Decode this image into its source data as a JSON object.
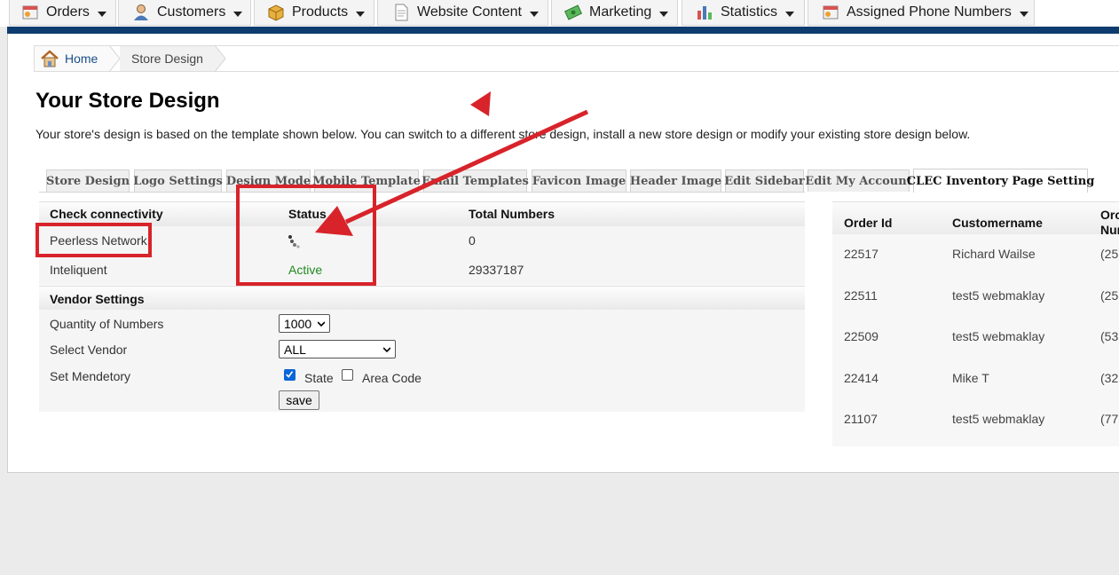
{
  "nav": {
    "items": [
      {
        "label": "Orders",
        "icon": "orders-icon"
      },
      {
        "label": "Customers",
        "icon": "customers-icon"
      },
      {
        "label": "Products",
        "icon": "products-icon"
      },
      {
        "label": "Website Content",
        "icon": "website-content-icon"
      },
      {
        "label": "Marketing",
        "icon": "marketing-icon"
      },
      {
        "label": "Statistics",
        "icon": "statistics-icon"
      },
      {
        "label": "Assigned Phone Numbers",
        "icon": "phone-numbers-icon"
      }
    ]
  },
  "breadcrumb": {
    "home": "Home",
    "current": "Store Design"
  },
  "page": {
    "title": "Your Store Design",
    "description": "Your store's design is based on the template shown below. You can switch to a different store design, install a new store design or modify your existing store design below."
  },
  "tabs": [
    "Store Design",
    "Logo Settings",
    "Design Mode",
    "Mobile Template",
    "Email Templates",
    "Favicon Image",
    "Header Image",
    "Edit Sidebar",
    "Edit My Account",
    "CLEC Inventory Page Setting"
  ],
  "connectivity": {
    "headers": {
      "network": "Check connectivity",
      "status": "Status",
      "total": "Total Numbers"
    },
    "rows": [
      {
        "network": "Peerless Network",
        "status": "",
        "status_icon": "loading-spinner-icon",
        "total": "0"
      },
      {
        "network": "Inteliquent",
        "status": "Active",
        "total": "29337187"
      }
    ]
  },
  "vendor": {
    "title": "Vendor Settings",
    "qty_label": "Quantity of Numbers",
    "qty_value": "1000",
    "vendor_label": "Select Vendor",
    "vendor_value": "ALL",
    "mandatory_label": "Set Mendetory",
    "state_label": "State",
    "state_checked": true,
    "area_label": "Area Code",
    "area_checked": false,
    "save_label": "save"
  },
  "orders": {
    "headers": {
      "id": "Order Id",
      "name": "Customername",
      "num_line1": "Orc",
      "num_line2": "Nur"
    },
    "rows": [
      {
        "id": "22517",
        "name": "Richard Wailse",
        "num": "(25"
      },
      {
        "id": "22511",
        "name": "test5 webmaklay",
        "num": "(25"
      },
      {
        "id": "22509",
        "name": "test5 webmaklay",
        "num": "(53"
      },
      {
        "id": "22414",
        "name": "Mike T",
        "num": "(32"
      },
      {
        "id": "21107",
        "name": "test5 webmaklay",
        "num": "(77"
      }
    ]
  },
  "colors": {
    "accent_bar": "#0e3c6e",
    "annotation_red": "#d8232a",
    "active_green": "#1f8a1f"
  }
}
